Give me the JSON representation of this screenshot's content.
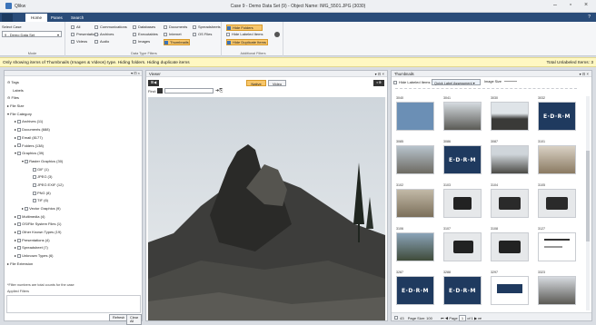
{
  "app": {
    "name": "Qlikw",
    "window_title": "Case 9 - Demo Data Set (9) - Object Name: IMG_5501.JPG (3030)"
  },
  "tabs": [
    {
      "label": "Home",
      "active": true
    },
    {
      "label": "Panes"
    },
    {
      "label": "Search"
    }
  ],
  "ribbon": {
    "case": {
      "label": "Select Case",
      "value": "9 - Demo Data Set",
      "group": "Mode"
    },
    "col1": [
      "All",
      "Presentations",
      "Videos"
    ],
    "col2": [
      "Communications",
      "Archives",
      "Audio"
    ],
    "col3": [
      "Databases",
      "Executables",
      "Images"
    ],
    "col4": [
      "Documents",
      "Internet",
      "Thumbnails"
    ],
    "col5": [
      "Spreadsheets",
      "OS Files"
    ],
    "group_data": "Data Type Filters",
    "filters": [
      "Hide Folders",
      "Hide Labeled Items",
      "Hide Duplicate Items"
    ],
    "group_filters": "Additional Filters"
  },
  "infobar": {
    "text": "Only showing items of Thumbnails (Images & Videos) type. Hiding folders. Hiding duplicate items",
    "right": "Total Unlabeled Items: 3"
  },
  "left_pane": {
    "tree": [
      {
        "label": "Tags"
      },
      {
        "label": "Labels"
      },
      {
        "label": "Files"
      },
      {
        "label": "File Size"
      },
      {
        "label": "File Category"
      },
      {
        "label": "Archives (11)"
      },
      {
        "label": "Documents (688)"
      },
      {
        "label": "Email (8177)"
      },
      {
        "label": "Folders (138)"
      },
      {
        "label": "Graphics (39)"
      },
      {
        "label": "Raster Graphics (30)"
      },
      {
        "label": "GIF (1)"
      },
      {
        "label": "JPEG (3)"
      },
      {
        "label": "JPEG EXIF (12)"
      },
      {
        "label": "PNG (8)"
      },
      {
        "label": "TIF (6)"
      },
      {
        "label": "Vector Graphics (9)"
      },
      {
        "label": "Multimedia (4)"
      },
      {
        "label": "OS/File System Files (1)"
      },
      {
        "label": "Other Known Types (19)"
      },
      {
        "label": "Presentations (4)"
      },
      {
        "label": "Spreadsheet (7)"
      },
      {
        "label": "Unknown Types (6)"
      },
      {
        "label": "File Extension"
      }
    ],
    "footnote": "*Filter numbers are total counts for the case",
    "applied": "Applied Filters",
    "refresh": "Refresh",
    "clear": "Clear All"
  },
  "viewer": {
    "title": "Viewer",
    "native": "Native",
    "video": "Video",
    "find_label": "Find:"
  },
  "thumbs": {
    "title": "Thumbnails",
    "hide_labeled": "Hide Labeled Items",
    "quick_label": "Quick Label Assessment",
    "image_size": "Image Size",
    "items": [
      "3040",
      "3041",
      "3030",
      "3032",
      "3085",
      "3086",
      "3087",
      "3101",
      "3102",
      "3103",
      "3104",
      "3105",
      "3106",
      "3107",
      "3108",
      "3127",
      "3287",
      "3288",
      "3297",
      "3323"
    ],
    "footer": {
      "count": "43",
      "page_size": "Page Size: 100",
      "page_label": "Page",
      "page": "1",
      "of": "of 1"
    }
  }
}
